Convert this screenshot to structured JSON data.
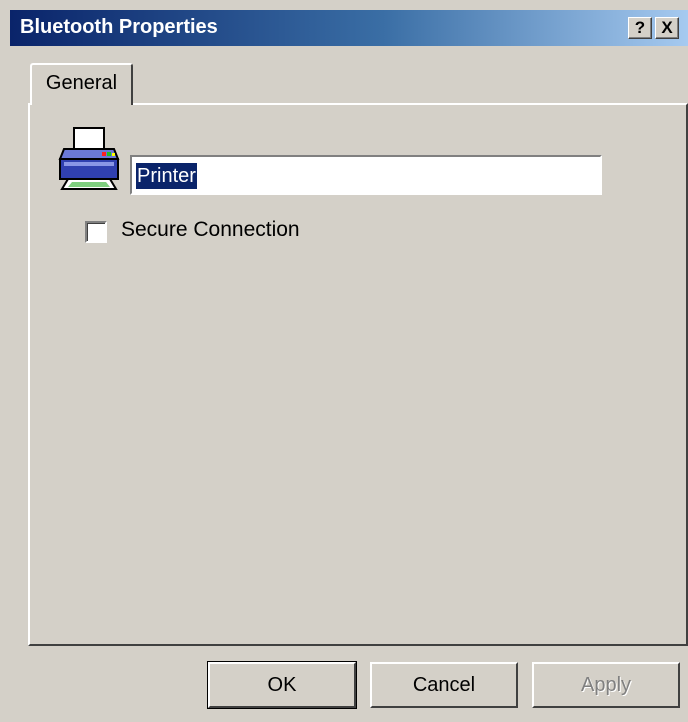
{
  "window": {
    "title": "Bluetooth Properties",
    "help_button": "?",
    "close_button": "X"
  },
  "tabs": [
    {
      "label": "General",
      "selected": true
    }
  ],
  "general": {
    "device_icon": "printer-icon",
    "name_value": "Printer",
    "secure_connection": {
      "label": "Secure Connection",
      "checked": false
    }
  },
  "buttons": {
    "ok": "OK",
    "cancel": "Cancel",
    "apply": "Apply"
  },
  "colors": {
    "title_gradient_start": "#0a246a",
    "title_gradient_end": "#a6caf0",
    "face": "#d4d0c8",
    "selection": "#0a246a"
  }
}
